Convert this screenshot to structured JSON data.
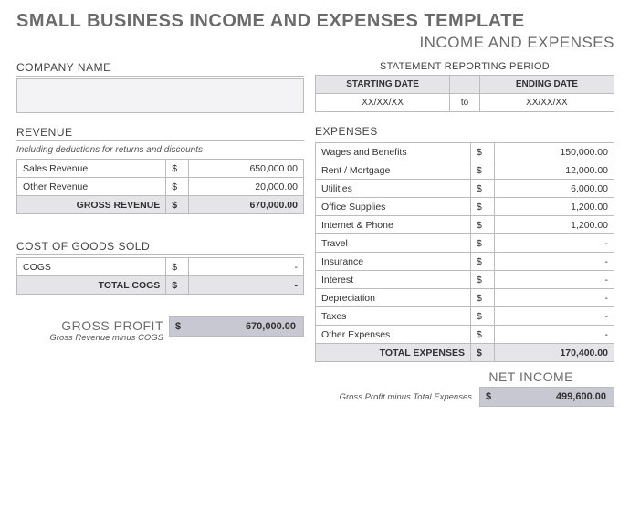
{
  "title": "SMALL BUSINESS INCOME AND EXPENSES TEMPLATE",
  "subtitle": "INCOME AND EXPENSES",
  "company": {
    "header": "COMPANY NAME",
    "value": ""
  },
  "period": {
    "header": "STATEMENT REPORTING PERIOD",
    "start_label": "STARTING DATE",
    "end_label": "ENDING DATE",
    "start_value": "XX/XX/XX",
    "to_label": "to",
    "end_value": "XX/XX/XX"
  },
  "revenue": {
    "header": "REVENUE",
    "note": "Including deductions for returns and discounts",
    "rows": [
      {
        "label": "Sales Revenue",
        "currency": "$",
        "value": "650,000.00"
      },
      {
        "label": "Other Revenue",
        "currency": "$",
        "value": "20,000.00"
      }
    ],
    "total_label": "GROSS REVENUE",
    "total_currency": "$",
    "total_value": "670,000.00"
  },
  "cogs": {
    "header": "COST OF GOODS SOLD",
    "rows": [
      {
        "label": "COGS",
        "currency": "$",
        "value": "-"
      }
    ],
    "total_label": "TOTAL COGS",
    "total_currency": "$",
    "total_value": "-"
  },
  "gross_profit": {
    "header": "GROSS PROFIT",
    "note": "Gross Revenue minus COGS",
    "currency": "$",
    "value": "670,000.00"
  },
  "expenses": {
    "header": "EXPENSES",
    "rows": [
      {
        "label": "Wages and Benefits",
        "currency": "$",
        "value": "150,000.00"
      },
      {
        "label": "Rent / Mortgage",
        "currency": "$",
        "value": "12,000.00"
      },
      {
        "label": "Utilities",
        "currency": "$",
        "value": "6,000.00"
      },
      {
        "label": "Office Supplies",
        "currency": "$",
        "value": "1,200.00"
      },
      {
        "label": "Internet & Phone",
        "currency": "$",
        "value": "1,200.00"
      },
      {
        "label": "Travel",
        "currency": "$",
        "value": "-"
      },
      {
        "label": "Insurance",
        "currency": "$",
        "value": "-"
      },
      {
        "label": "Interest",
        "currency": "$",
        "value": "-"
      },
      {
        "label": "Depreciation",
        "currency": "$",
        "value": "-"
      },
      {
        "label": "Taxes",
        "currency": "$",
        "value": "-"
      },
      {
        "label": "Other Expenses",
        "currency": "$",
        "value": "-"
      }
    ],
    "total_label": "TOTAL EXPENSES",
    "total_currency": "$",
    "total_value": "170,400.00"
  },
  "net_income": {
    "header": "NET INCOME",
    "note": "Gross Profit minus Total Expenses",
    "currency": "$",
    "value": "499,600.00"
  }
}
